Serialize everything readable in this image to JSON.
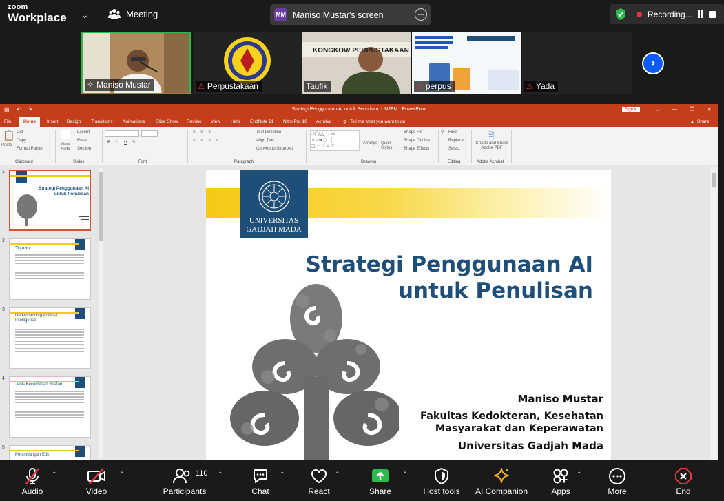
{
  "topbar": {
    "logo_line1": "zoom",
    "logo_line2": "Workplace",
    "meeting_label": "Meeting",
    "share_initials": "MM",
    "share_title": "Maniso Mustar's screen",
    "recording_label": "Recording..."
  },
  "gallery": [
    {
      "name": "Maniso Mustar",
      "muted": false
    },
    {
      "name": "Perpustakaan",
      "muted": true
    },
    {
      "name": "Taufik",
      "muted": false
    },
    {
      "name": "perpus",
      "muted": true
    },
    {
      "name": "Yada",
      "muted": true
    }
  ],
  "gallery_banner_text": "KONGKOW PERPUSTAKAAN",
  "ppt": {
    "window_title": "Strategi Penggunaan AI untuk Penulisan. UNJEM  ·  PowerPoint",
    "signin": "Sign in",
    "tabs": [
      "File",
      "Home",
      "Insert",
      "Design",
      "Transitions",
      "Animations",
      "Slide Show",
      "Review",
      "View",
      "Help",
      "EndNote 21",
      "Nitro Pro 10",
      "Acrobat"
    ],
    "tell_me": "Tell me what you want to do",
    "share": "Share",
    "groups": [
      "Clipboard",
      "Slides",
      "Font",
      "Paragraph",
      "Drawing",
      "Editing",
      "Adobe Acrobat"
    ],
    "ribbon_items": {
      "paste": "Paste",
      "cut": "Cut",
      "copy": "Copy",
      "format_painter": "Format Painter",
      "new_slide": "New Slide",
      "layout": "Layout",
      "reset": "Reset",
      "section": "Section",
      "text_direction": "Text Direction",
      "align_text": "Align Text",
      "convert_smartart": "Convert to SmartArt",
      "arrange": "Arrange",
      "quick_styles": "Quick Styles",
      "shape_fill": "Shape Fill",
      "shape_outline": "Shape Outline",
      "shape_effects": "Shape Effects",
      "find": "Find",
      "replace": "Replace",
      "select": "Select",
      "create_pdf": "Create and Share Adobe PDF"
    },
    "thumbs": [
      {
        "num": "1",
        "title": "Strategi Penggunaan AI untuk Penulisan"
      },
      {
        "num": "2",
        "title": "Tujuan"
      },
      {
        "num": "3",
        "title": "Understanding Artificial Intelligence"
      },
      {
        "num": "4",
        "title": "Jenis Kecerdasan Buatan"
      },
      {
        "num": "5",
        "title": "Pertimbangan Etis"
      }
    ],
    "slide": {
      "university_line1": "UNIVERSITAS",
      "university_line2": "GADJAH MADA",
      "title_line1": "Strategi Penggunaan AI",
      "title_line2": "untuk Penulisan",
      "author": "Maniso Mustar",
      "faculty_line1": "Fakultas Kedokteran, Kesehatan",
      "faculty_line2": "Masyarakat dan Keperawatan",
      "university": "Universitas Gadjah Mada"
    }
  },
  "toolbar": {
    "audio": "Audio",
    "video": "Video",
    "participants": "Participants",
    "participants_count": "110",
    "chat": "Chat",
    "react": "React",
    "share": "Share",
    "host_tools": "Host tools",
    "ai_companion": "AI Companion",
    "apps": "Apps",
    "more": "More",
    "end": "End"
  },
  "colors": {
    "zoom_blue": "#0b5cff",
    "ppt_red": "#c43e1c",
    "ugm_blue": "#1f4e79",
    "slide_yellow": "#f6c915",
    "share_green": "#2eb94d",
    "end_red": "#e0383e"
  }
}
